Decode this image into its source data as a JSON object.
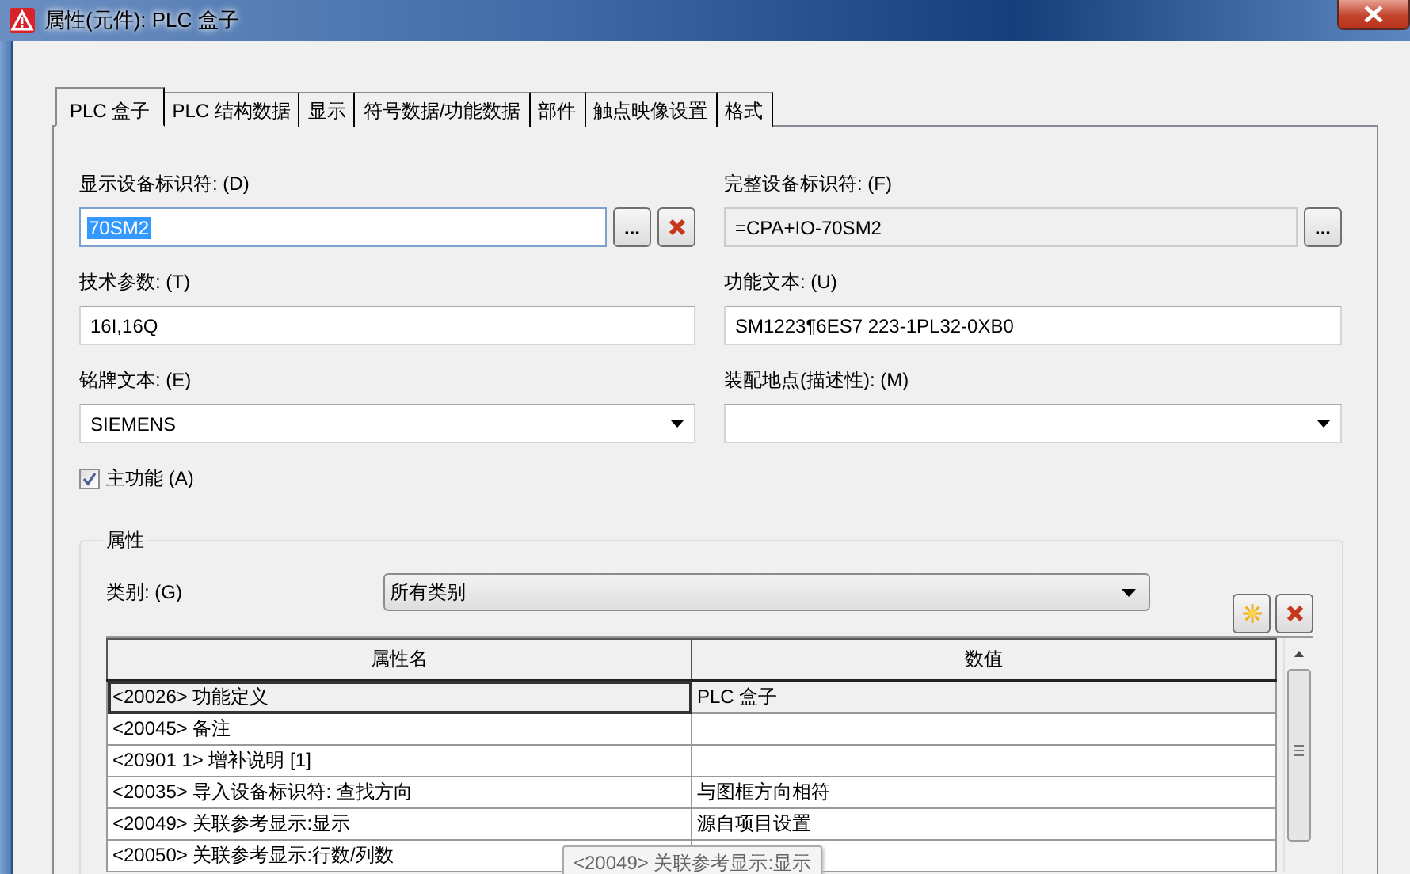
{
  "window": {
    "title": "属性(元件): PLC 盒子"
  },
  "tabs": [
    {
      "label": "PLC 盒子",
      "selected": true
    },
    {
      "label": "PLC 结构数据",
      "selected": false
    },
    {
      "label": "显示",
      "selected": false
    },
    {
      "label": "符号数据/功能数据",
      "selected": false
    },
    {
      "label": "部件",
      "selected": false
    },
    {
      "label": "触点映像设置",
      "selected": false
    },
    {
      "label": "格式",
      "selected": false
    }
  ],
  "fields": [
    {
      "label": "显示设备标识符: (D)",
      "kind": "text",
      "value": "70SM2",
      "highlighted": true,
      "readonly": false,
      "buttons": [
        {
          "kind": "browse",
          "label": "..."
        },
        {
          "kind": "clear"
        }
      ]
    },
    {
      "label": "完整设备标识符: (F)",
      "kind": "text",
      "value": "=CPA+IO-70SM2",
      "highlighted": false,
      "readonly": true,
      "buttons": [
        {
          "kind": "browse",
          "label": "..."
        }
      ]
    },
    {
      "label": "技术参数: (T)",
      "kind": "text",
      "value": "16I,16Q",
      "highlighted": false,
      "readonly": false
    },
    {
      "label": "功能文本: (U)",
      "kind": "text",
      "value": "SM1223¶6ES7 223-1PL32-0XB0",
      "highlighted": false,
      "readonly": false
    },
    {
      "label": "铭牌文本: (E)",
      "kind": "combo",
      "value": "SIEMENS",
      "highlighted": false,
      "readonly": false
    },
    {
      "label": "装配地点(描述性): (M)",
      "kind": "combo",
      "highlighted": false,
      "readonly": false
    }
  ],
  "main_function": {
    "label": "主功能 (A)",
    "checked": true
  },
  "properties": {
    "title": "属性",
    "category": {
      "label": "类别: (G)",
      "value": "所有类别"
    },
    "tool_buttons": [
      {
        "kind": "new"
      },
      {
        "kind": "delete"
      }
    ],
    "columns": [
      "属性名",
      "数值"
    ],
    "rows": [
      {
        "name": "<20026> 功能定义",
        "value": "PLC 盒子",
        "selected": true
      },
      {
        "name": "<20045> 备注",
        "selected": false
      },
      {
        "name": "<20901 1> 增补说明 [1]",
        "selected": false
      },
      {
        "name": "<20035> 导入设备标识符: 查找方向",
        "value": "与图框方向相符",
        "selected": false
      },
      {
        "name": "<20049> 关联参考显示:显示",
        "value": "源自项目设置",
        "selected": false
      },
      {
        "name": "<20050> 关联参考显示:行数/列数",
        "selected": false
      }
    ],
    "tooltip": "<20049> 关联参考显示:显示"
  }
}
